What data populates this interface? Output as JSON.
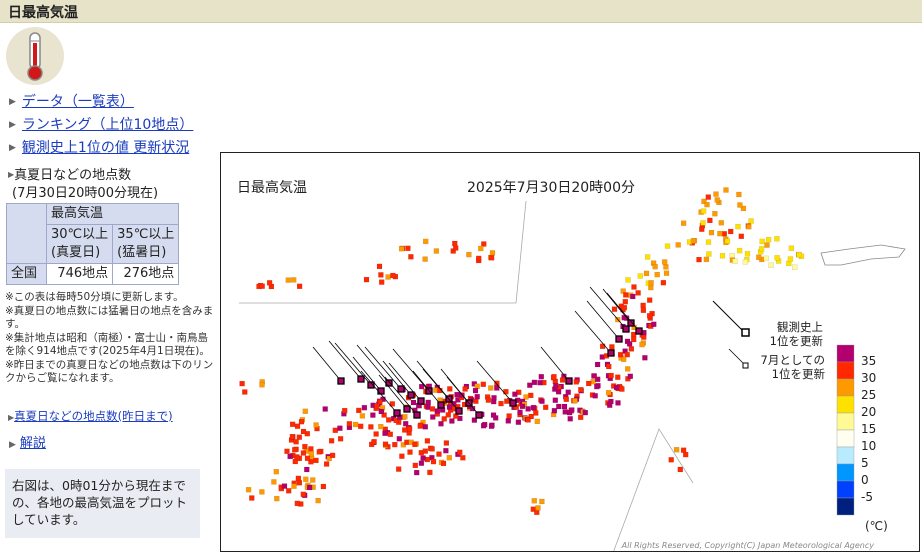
{
  "header": {
    "title": "日最高気温"
  },
  "links": [
    {
      "label": "データ（一覧表）"
    },
    {
      "label": "ランキング（上位10地点）"
    },
    {
      "label": "観測史上1位の値 更新状況"
    }
  ],
  "counts": {
    "title_line1": "真夏日などの地点数",
    "title_line2": "(7月30日20時00分現在)",
    "col_group": "最高気温",
    "col1": "30℃以上\n(真夏日)",
    "col1_a": "30℃以上",
    "col1_b": "(真夏日)",
    "col2_a": "35℃以上",
    "col2_b": "(猛暑日)",
    "row_label": "全国",
    "val1": "746地点",
    "val2": "276地点"
  },
  "notes": [
    "※この表は毎時50分頃に更新します。",
    "※真夏日の地点数には猛暑日の地点を含みます。",
    "※集計地点は昭和（南極）・富士山・南鳥島を除く914地点です(2025年4月1日現在)。",
    "※昨日までの真夏日などの地点数は下のリンクからご覧になれます。"
  ],
  "yesterday_link": "真夏日などの地点数(昨日まで)",
  "kaisetsu_link": "解説",
  "description": "右図は、0時01分から現在までの、各地の最高気温をプロットしています。",
  "map": {
    "title": "日最高気温",
    "time": "2025年7月30日20時00分",
    "legend_record_line1": "観測史上",
    "legend_record_line2": "1位を更新",
    "legend_july_line1": "7月としての",
    "legend_july_line2": "1位を更新",
    "scale_labels": [
      "35",
      "30",
      "25",
      "20",
      "15",
      "10",
      "5",
      "0",
      "-5"
    ],
    "scale_colors": [
      "#b4006e",
      "#ff2800",
      "#ff9900",
      "#ffe100",
      "#fffa96",
      "#ffffef",
      "#b9ebff",
      "#0096ff",
      "#0041ff",
      "#002080"
    ],
    "unit": "(℃)",
    "credit": "All Rights Reserved, Copyright(C) Japan Meteorological Agency"
  }
}
